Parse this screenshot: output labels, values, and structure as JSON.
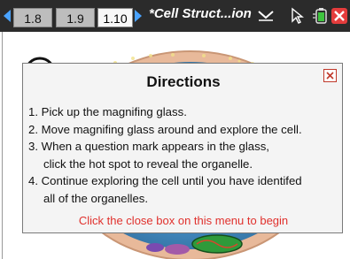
{
  "toolbar": {
    "tabs": [
      {
        "label": "1.8"
      },
      {
        "label": "1.9"
      },
      {
        "label": "1.10"
      }
    ],
    "active_tab": "1.10",
    "document_title": "*Cell Struct...ion"
  },
  "dialog": {
    "title": "Directions",
    "steps": [
      "1. Pick up the magnifing glass.",
      "2. Move magnifing glass around and explore the cell.",
      "3. When a question mark appears in the glass,",
      "click the hot spot to reveal the organelle.",
      "4. Continue exploring the cell until you have identifed",
      "all of the organelles."
    ],
    "footer": "Click the close box on this menu to begin"
  },
  "colors": {
    "toolbar_bg": "#2b2b2b",
    "nav_arrow": "#4aa3ff",
    "footer_text": "#e0302c",
    "close_red": "#c0392b"
  }
}
